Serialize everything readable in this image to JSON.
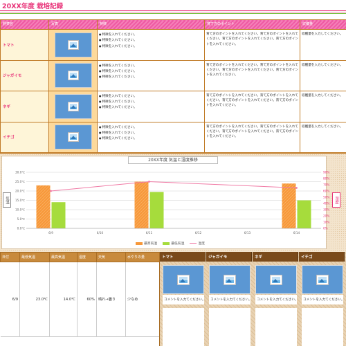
{
  "page_title": "20XX年度 栽培記録",
  "crop_table": {
    "headers": [
      "野菜名",
      "写真",
      "特徴",
      "育て方のポイント",
      "収穫量"
    ],
    "rows": [
      {
        "name": "トマト",
        "features": [
          "特徴を入れてください。",
          "特徴を入れてください。",
          "特徴を入れてください。"
        ],
        "points": "育て方のポイントを入れてください。育て方のポイントを入れてください。育て方のポイントを入れてください。育て方のポイントを入れてください。",
        "harvest": "収穫量を入力してください。"
      },
      {
        "name": "ジャガイモ",
        "features": [
          "特徴を入れてください。",
          "特徴を入れてください。",
          "特徴を入れてください。"
        ],
        "points": "育て方のポイントを入れてください。育て方のポイントを入れてください。育て方のポイントを入れてください。育て方のポイントを入れてください。",
        "harvest": "収穫量を入力してください。"
      },
      {
        "name": "ネギ",
        "features": [
          "特徴を入れてください。",
          "特徴を入れてください。",
          "特徴を入れてください。"
        ],
        "points": "育て方のポイントを入れてください。育て方のポイントを入れてください。育て方のポイントを入れてください。育て方のポイントを入れてください。",
        "harvest": "収穫量を入力してください。"
      },
      {
        "name": "イチゴ",
        "features": [
          "特徴を入れてください。",
          "特徴を入れてください。",
          "特徴を入れてください。"
        ],
        "points": "育て方のポイントを入れてください。育て方のポイントを入れてください。育て方のポイントを入れてください。育て方のポイントを入れてください。",
        "harvest": "収穫量を入力してください。"
      }
    ]
  },
  "chart_data": {
    "type": "bar",
    "title": "20XX年度 気温と湿度推移",
    "ylabel_left": "気温",
    "ylabel_right": "湿度",
    "categories": [
      "6/9",
      "6/10",
      "6/11",
      "6/12",
      "6/13",
      "6/14"
    ],
    "series": [
      {
        "name": "最高気温",
        "type": "bar",
        "axis": "left",
        "color": "#f7983a",
        "values": [
          23.0,
          null,
          25.0,
          null,
          null,
          24.0
        ]
      },
      {
        "name": "最低気温",
        "type": "bar",
        "axis": "left",
        "color": "#a6dc3c",
        "values": [
          14.0,
          null,
          19.5,
          null,
          null,
          15.0
        ]
      },
      {
        "name": "湿度",
        "type": "line",
        "axis": "right",
        "color": "#f07aa5",
        "values": [
          60,
          null,
          75,
          null,
          null,
          65
        ]
      }
    ],
    "ylim_left": [
      0,
      30
    ],
    "yticks_left": [
      "0.0℃",
      "5.0℃",
      "10.0℃",
      "15.0℃",
      "20.0℃",
      "25.0℃",
      "30.0℃"
    ],
    "ylim_right": [
      0,
      90
    ],
    "yticks_right": [
      "0%",
      "10%",
      "20%",
      "30%",
      "40%",
      "50%",
      "60%",
      "70%",
      "80%",
      "90%"
    ],
    "legend": "bottom",
    "grid": true
  },
  "log_table": {
    "headers": [
      "日付",
      "最低気温",
      "最高気温",
      "湿度",
      "天気",
      "水やりの量"
    ],
    "row": {
      "date": "6/9",
      "min_temp": "23.0℃",
      "max_temp": "14.0℃",
      "humidity": "60%",
      "weather": "晴れ→曇り",
      "water": "少なめ"
    }
  },
  "gallery": {
    "columns": [
      {
        "name": "トマト",
        "comment": "コメントを入力てください。"
      },
      {
        "name": "ジャガイモ",
        "comment": "コメントを入力てください。"
      },
      {
        "name": "ネギ",
        "comment": "コメントを入力てください。"
      },
      {
        "name": "イチゴ",
        "comment": "コメントを入力てください。"
      }
    ]
  },
  "icons": {
    "photo_placeholder": "image-placeholder-icon"
  },
  "colors": {
    "accent_pink": "#e8357a",
    "accent_green": "#7cc242",
    "brown": "#c07a26"
  }
}
